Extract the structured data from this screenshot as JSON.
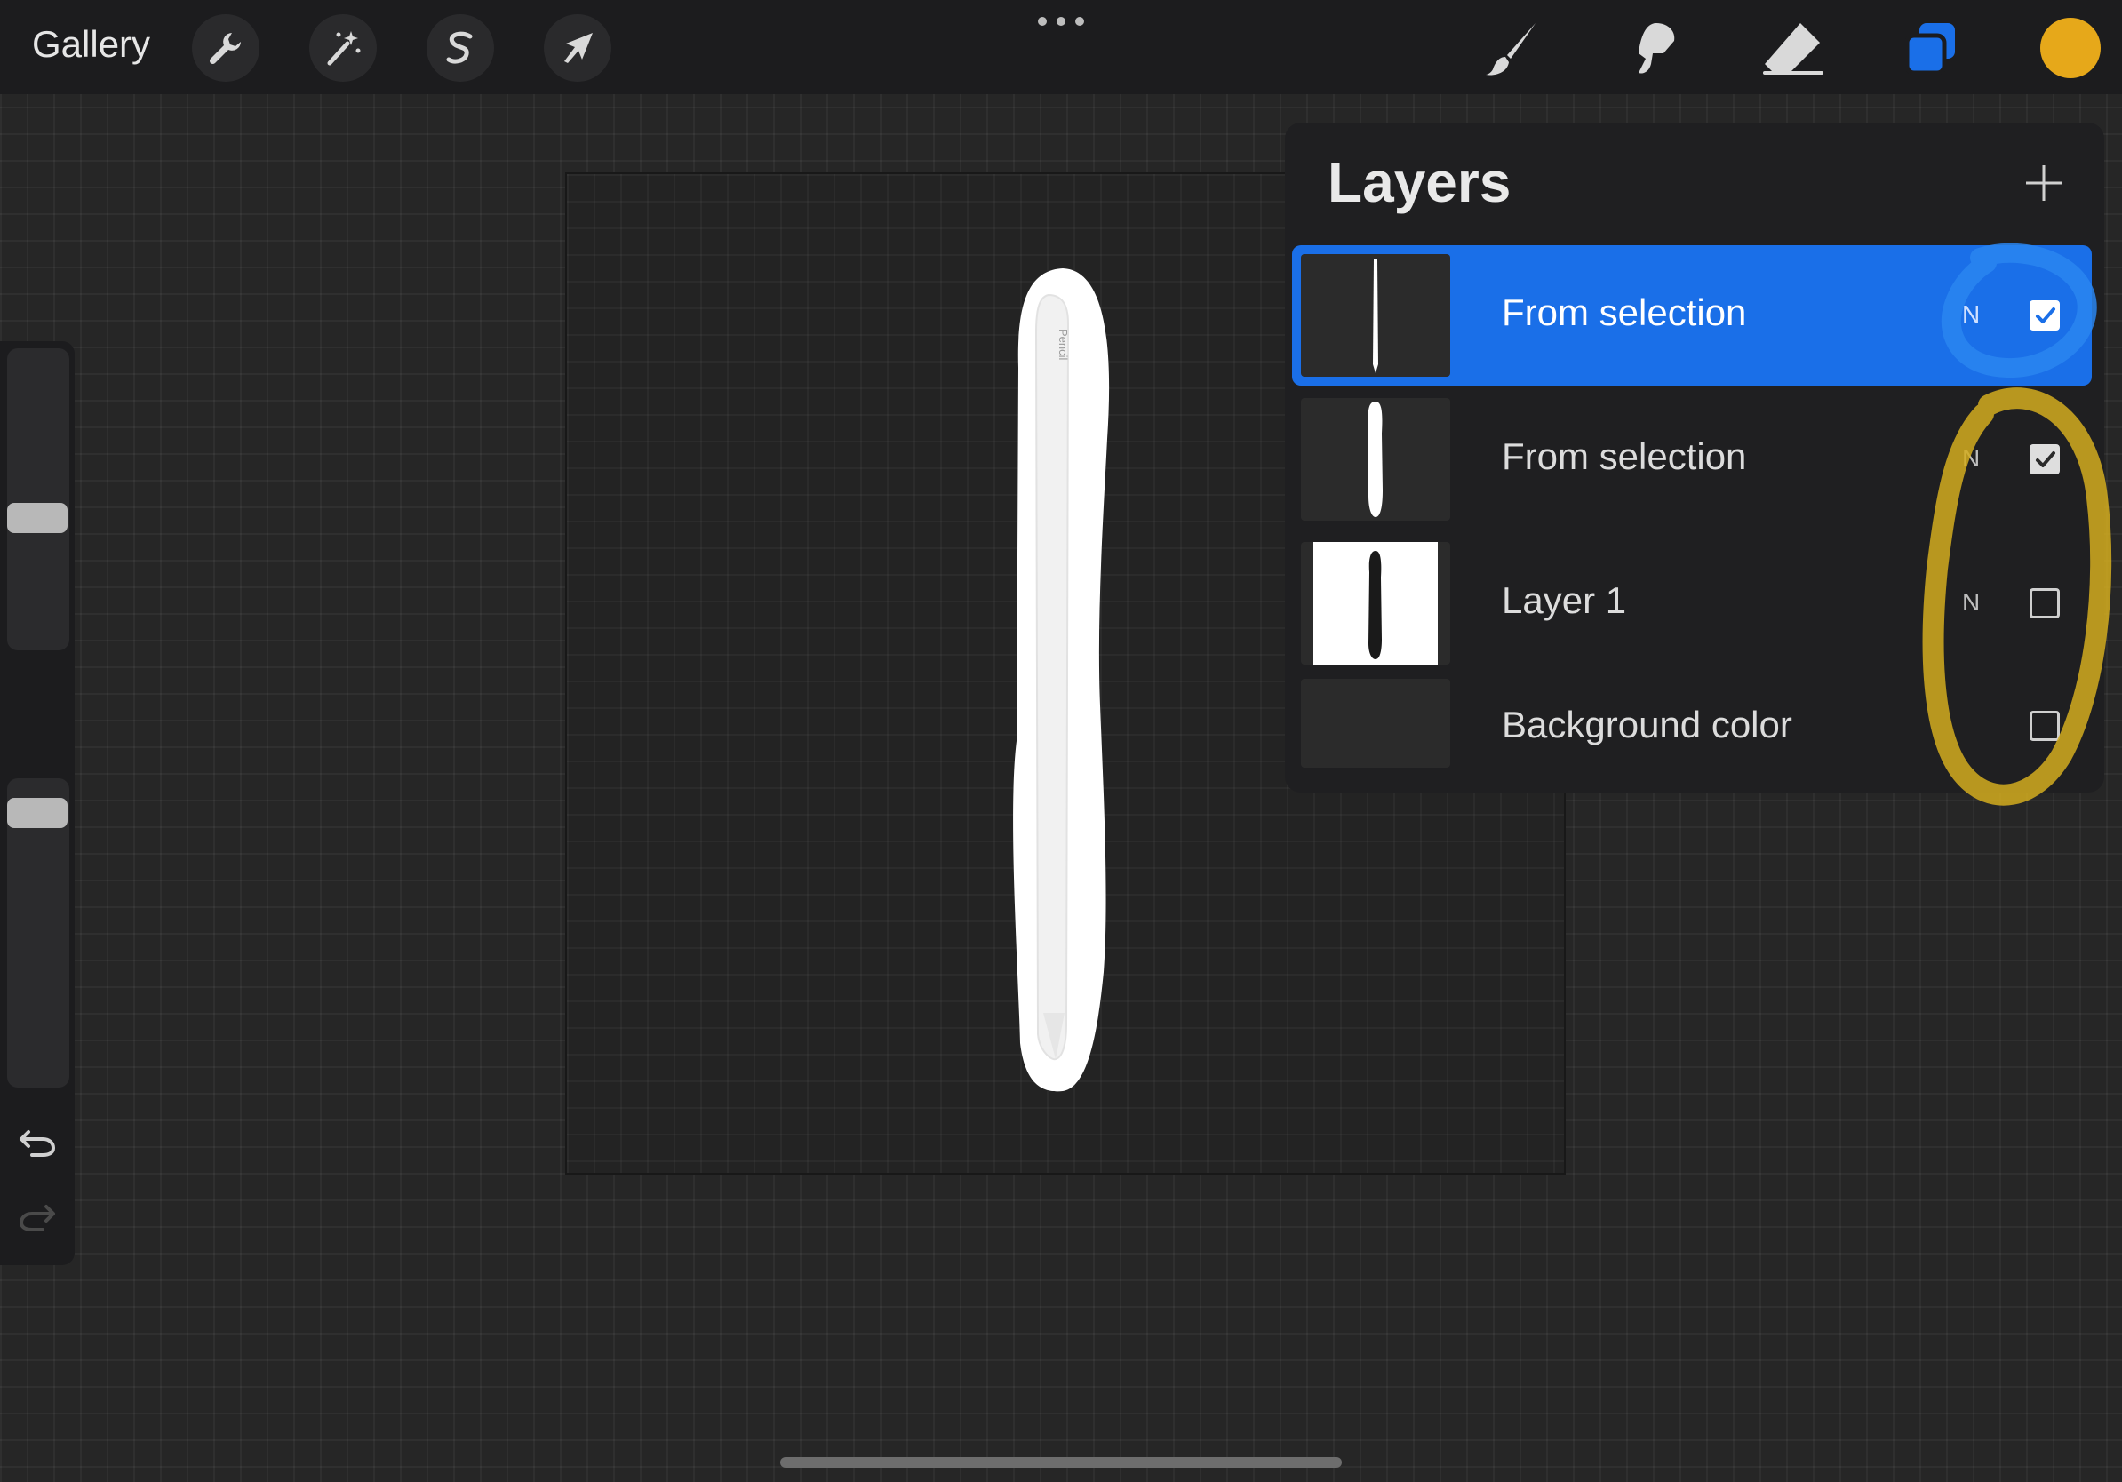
{
  "topbar": {
    "gallery_label": "Gallery",
    "tools_left": [
      "wrench-icon",
      "magic-wand-icon",
      "selection-s-icon",
      "transform-arrow-icon"
    ],
    "tools_right": [
      "brush-icon",
      "smudge-icon",
      "eraser-icon",
      "layers-icon"
    ],
    "current_color": "#e6a81a"
  },
  "layers": {
    "title": "Layers",
    "items": [
      {
        "name": "From selection",
        "blend": "N",
        "visible": true,
        "active": true
      },
      {
        "name": "From selection",
        "blend": "N",
        "visible": true,
        "active": false
      },
      {
        "name": "Layer 1",
        "blend": "N",
        "visible": false,
        "active": false
      },
      {
        "name": "Background color",
        "blend": "",
        "visible": false,
        "active": false
      }
    ]
  },
  "canvas": {
    "pencil_label": "Pencil"
  },
  "colors": {
    "accent_blue": "#1a6fe8",
    "annotation_yellow": "#d4ad1f",
    "annotation_blue": "#2a86f0"
  }
}
